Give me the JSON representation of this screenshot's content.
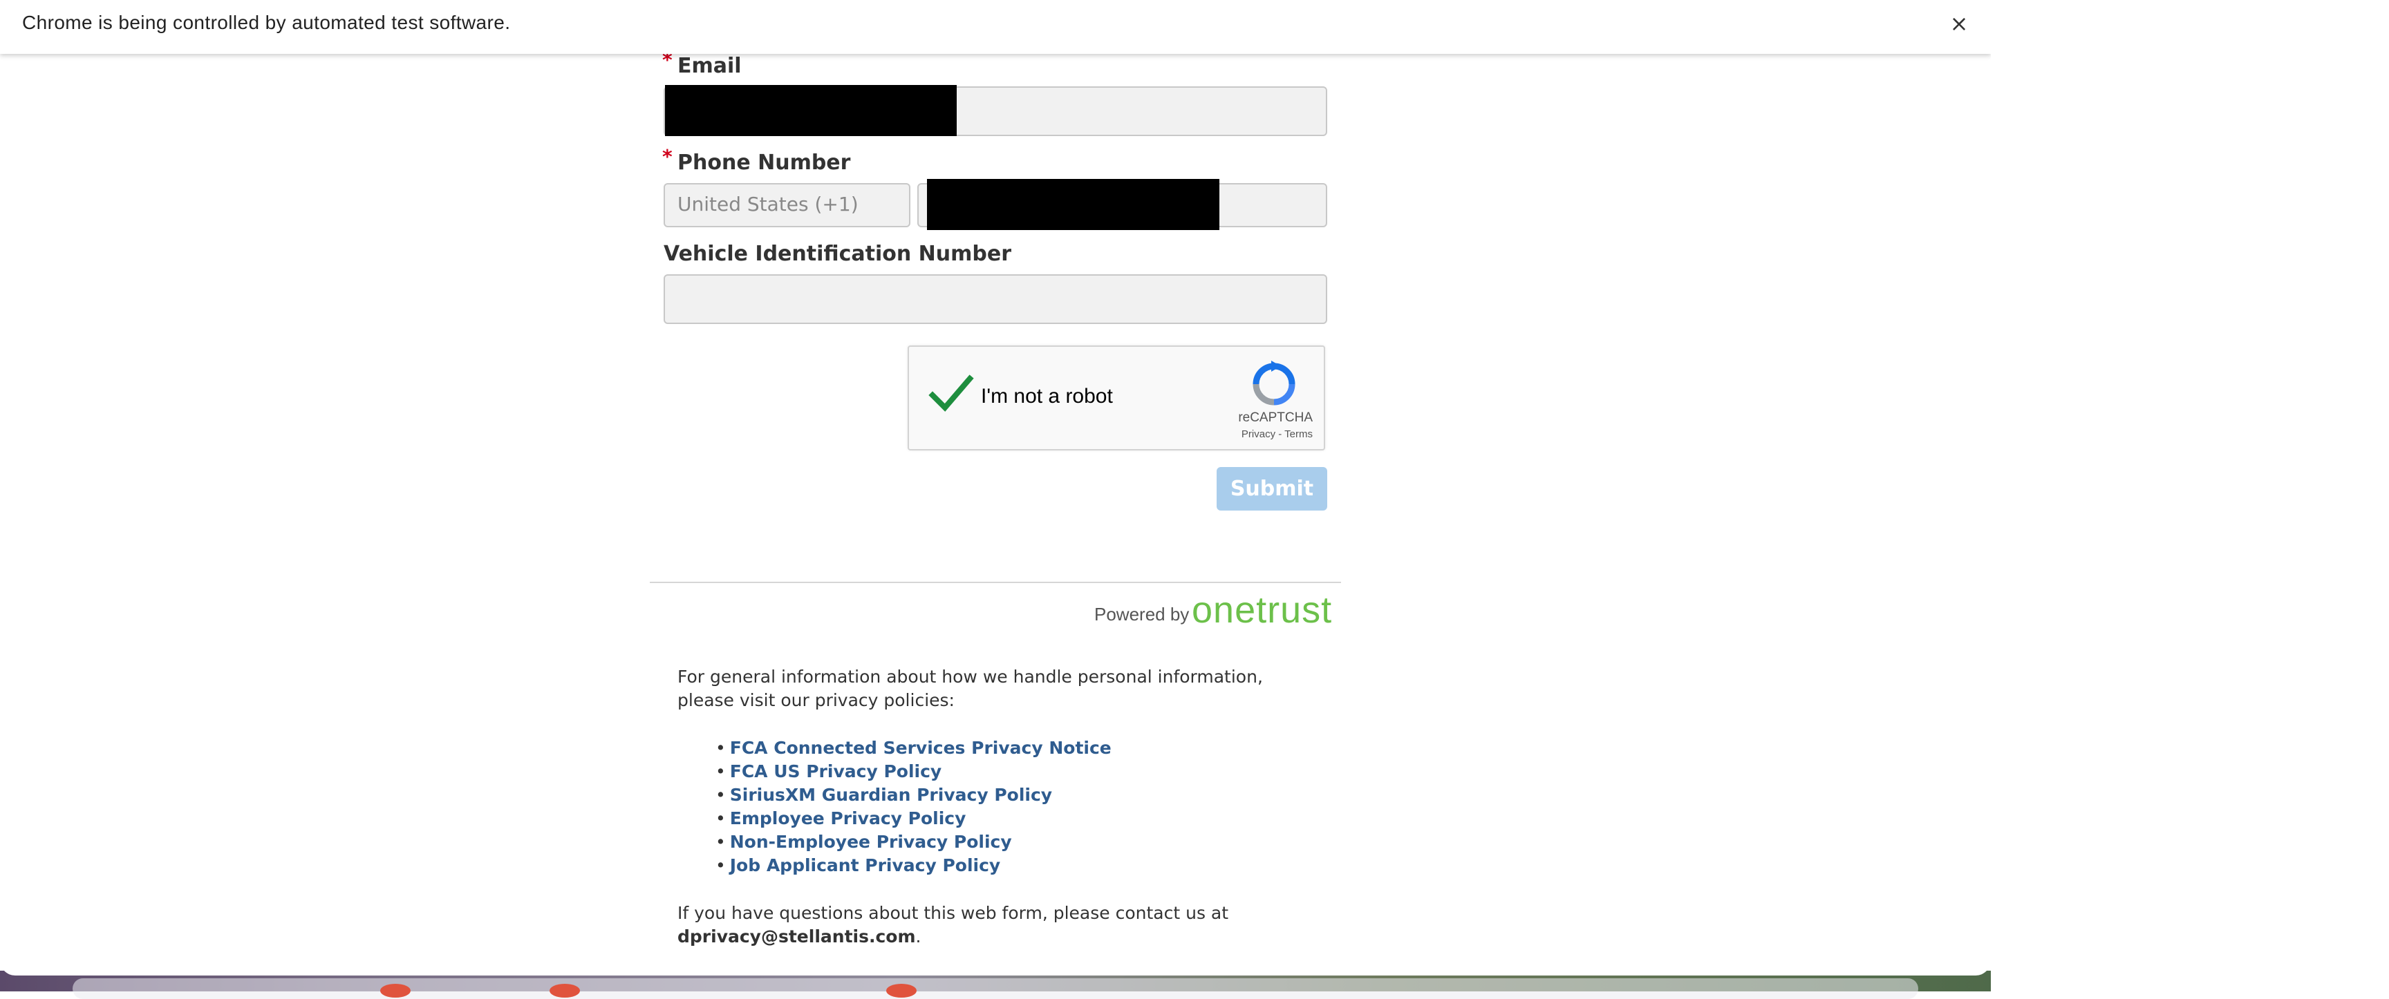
{
  "infobar": {
    "message": "Chrome is being controlled by automated test software.",
    "close_icon": "×"
  },
  "form": {
    "required_marker": "*",
    "email_label": "Email",
    "phone_label": "Phone Number",
    "phone_country_value": "United States (+1)",
    "vin_label": "Vehicle Identification Number",
    "vin_value": "",
    "submit_label": "Submit"
  },
  "recaptcha": {
    "label": "I'm not a robot",
    "brand": "reCAPTCHA",
    "links": "Privacy - Terms",
    "checked": true
  },
  "footer": {
    "powered_by": "Powered by",
    "logo_text": "onetrust",
    "intro": "For general information about how we handle personal information, please visit our privacy policies:",
    "policies": [
      "FCA Connected Services Privacy Notice",
      "FCA US Privacy Policy",
      "SiriusXM Guardian Privacy Policy",
      "Employee Privacy Policy",
      "Non-Employee Privacy Policy",
      "Job Applicant Privacy Policy"
    ],
    "bullet": "•",
    "contact_text": "If you have questions about this web form, please contact us at",
    "contact_email": "dprivacy@stellantis.com",
    "contact_end": "."
  },
  "colors": {
    "link": "#2f5c8f",
    "submit_disabled": "#a9cdec",
    "required": "#d0021b",
    "onetrust_green": "#6cc04a",
    "recaptcha_check": "#1e8e3e"
  }
}
